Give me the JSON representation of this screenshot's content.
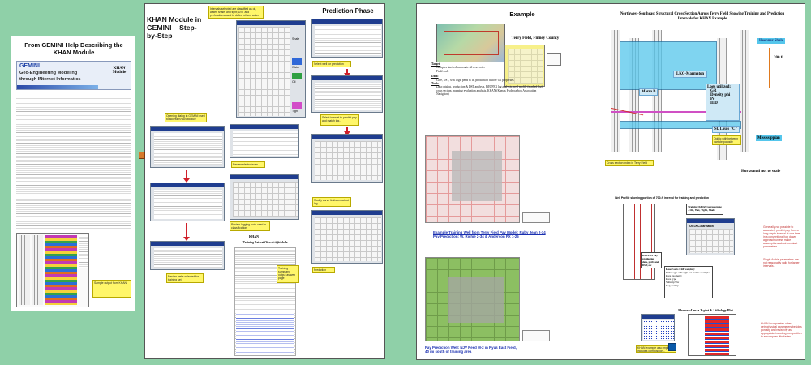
{
  "poster1": {
    "title": "From GEMINI Help Describing the KHAN Module",
    "logo_line1": "GEMINI",
    "logo_line2": "Geo-Engineering Modeling",
    "logo_line3": "through INternet Informatics",
    "logo_right": "KHAN Module",
    "caption": "Sample output from KHAN"
  },
  "poster2": {
    "title": "KHAN Module in GEMINI – Step-by-Step",
    "prediction_title": "Prediction Phase",
    "notes": {
      "top": "Intervals selected are classified as oil, water, shale, and tight; DST and perforations used to define oil and water zones",
      "open": "Opening dialog in GEMINI used to access KHAN Module",
      "review": "Review electrofacies",
      "review_logs": "Review logging tools used in classification",
      "review_wells": "Review wells selected for training set",
      "select_well": "Select well for prediction",
      "select_interval": "Select interval to predict pay and match log...",
      "modify": "Modify curve limits on output log",
      "prediction": "Prediction",
      "training": "Training summary output as web page"
    },
    "khan_label": "KHAN",
    "training_dataset_title": "Training Dataset Oil-wet tight shale",
    "log_legend": [
      "Shale",
      "Water",
      "Oil",
      "Tight"
    ]
  },
  "poster3": {
    "example_title": "Example",
    "field_title": "Terry Field, Finney County",
    "target_label": "Target:",
    "target_items": [
      "Complex stacked carbonate oil reservoirs",
      "Field scale"
    ],
    "data_label": "Data:",
    "data_text": "Core, DST, well logs, perfs & IP, production history Oil properties",
    "tools_label": "Tools:",
    "tools_text": "Data catalog, production & DST analysis, PfEFFER log analysis, well profile (marked log), cross section, mapping evaluation analysis, KHAN (Kansas Hydrocarbon Association Navigator)",
    "map1_caption_line1": "Example Training Well from Terry Field Pay Model: Ruby Jean 2-34",
    "map1_caption_line2": "Pay Prediction: W. Richie 2-34 & Anderson PX 1-25",
    "map2_caption_line1": "Pay Prediction Well: NJV Reed M-2 in Ryus East Field,",
    "map2_caption_line2": "40 mi south of training area",
    "cross_section_title": "Northwest-Southeast Structural Cross Section Across Terry Field Showing Training and Prediction Intervals for KHAN Example",
    "heebner": "Heebner Shale",
    "thickness": "200 ft",
    "lkc": "LKC-Marmaton",
    "marm": "Marm B",
    "logs_title": "Logs utilized:",
    "logs": [
      "GR",
      "Density phi",
      "Pe",
      "ILD"
    ],
    "st_louis": "St. Louis \"C\"",
    "oolite_note": "Oolitic with between particle porosity",
    "mississippian": "Mississippian",
    "horizontal_note": "Horizontal not to scale",
    "cross_section_caption": "Cross section index in Terry Field",
    "well_profile_title": "Well Profile showing portion of 700-ft interval for training and prediction",
    "training_box": "Training KHAN to recognize – Oil, Wet, Tight, Shale",
    "lkc_marmaton_label": "Oil LKC-Marmaton",
    "note_generally": "Generally not possible to accurately predict pay from a long depth interval at one time in a conventional top down approach unless make assumptions about constant parameters.",
    "note_single": "Single Archie parameters are not reasonably valid for larger intervals.",
    "reservoir_label": "Reservoirs with varying:",
    "reservoir_items": [
      "Lithology: although not in this example",
      "Pore geometry",
      "Pore type",
      "Salinity/Rw",
      "Log quality"
    ],
    "pay_label": "DST/Perf Pay production data, perfs and DST, etc",
    "rhomaa_title": "Rhomaa-Umaa X-plot & Lithology Plot",
    "khan_confirm": "KHAN example also implicitly includes composition...",
    "khan_incorporates": "KHAN incorporates other petrophysical parameters besides porosity and resistivity as appropriate including composition to encompass lithofacies."
  },
  "colors": {
    "background": "#8fd0a8",
    "note_yellow": "#fff66a",
    "arrow_red": "#d0202a",
    "link_blue": "#1a2fb0",
    "cross_blue": "#55c6ec"
  }
}
